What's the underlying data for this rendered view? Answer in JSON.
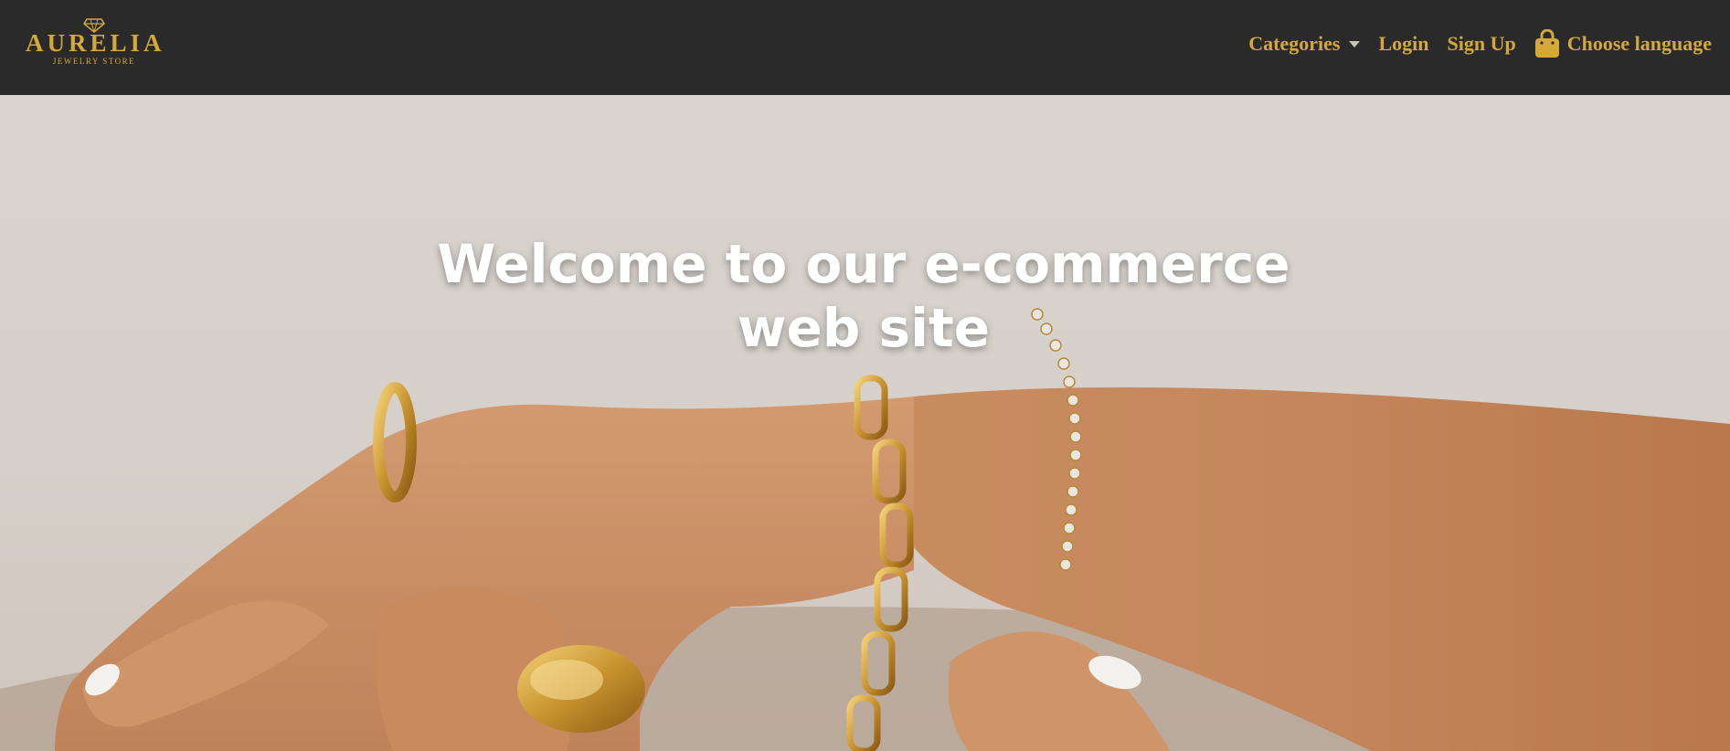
{
  "brand": {
    "name": "AURELIA",
    "subtitle": "JEWELRY STORE"
  },
  "nav": {
    "categories_label": "Categories",
    "login_label": "Login",
    "signup_label": "Sign Up",
    "language_label": "Choose language"
  },
  "hero": {
    "title": "Welcome to our e-commerce web site"
  },
  "colors": {
    "navbar_bg": "#2a2a2a",
    "accent_gold": "#d4a93a",
    "hero_text": "#ffffff"
  },
  "icons": {
    "brand": "diamond-icon",
    "dropdown": "caret-down-icon",
    "language": "shopping-bag-icon"
  }
}
